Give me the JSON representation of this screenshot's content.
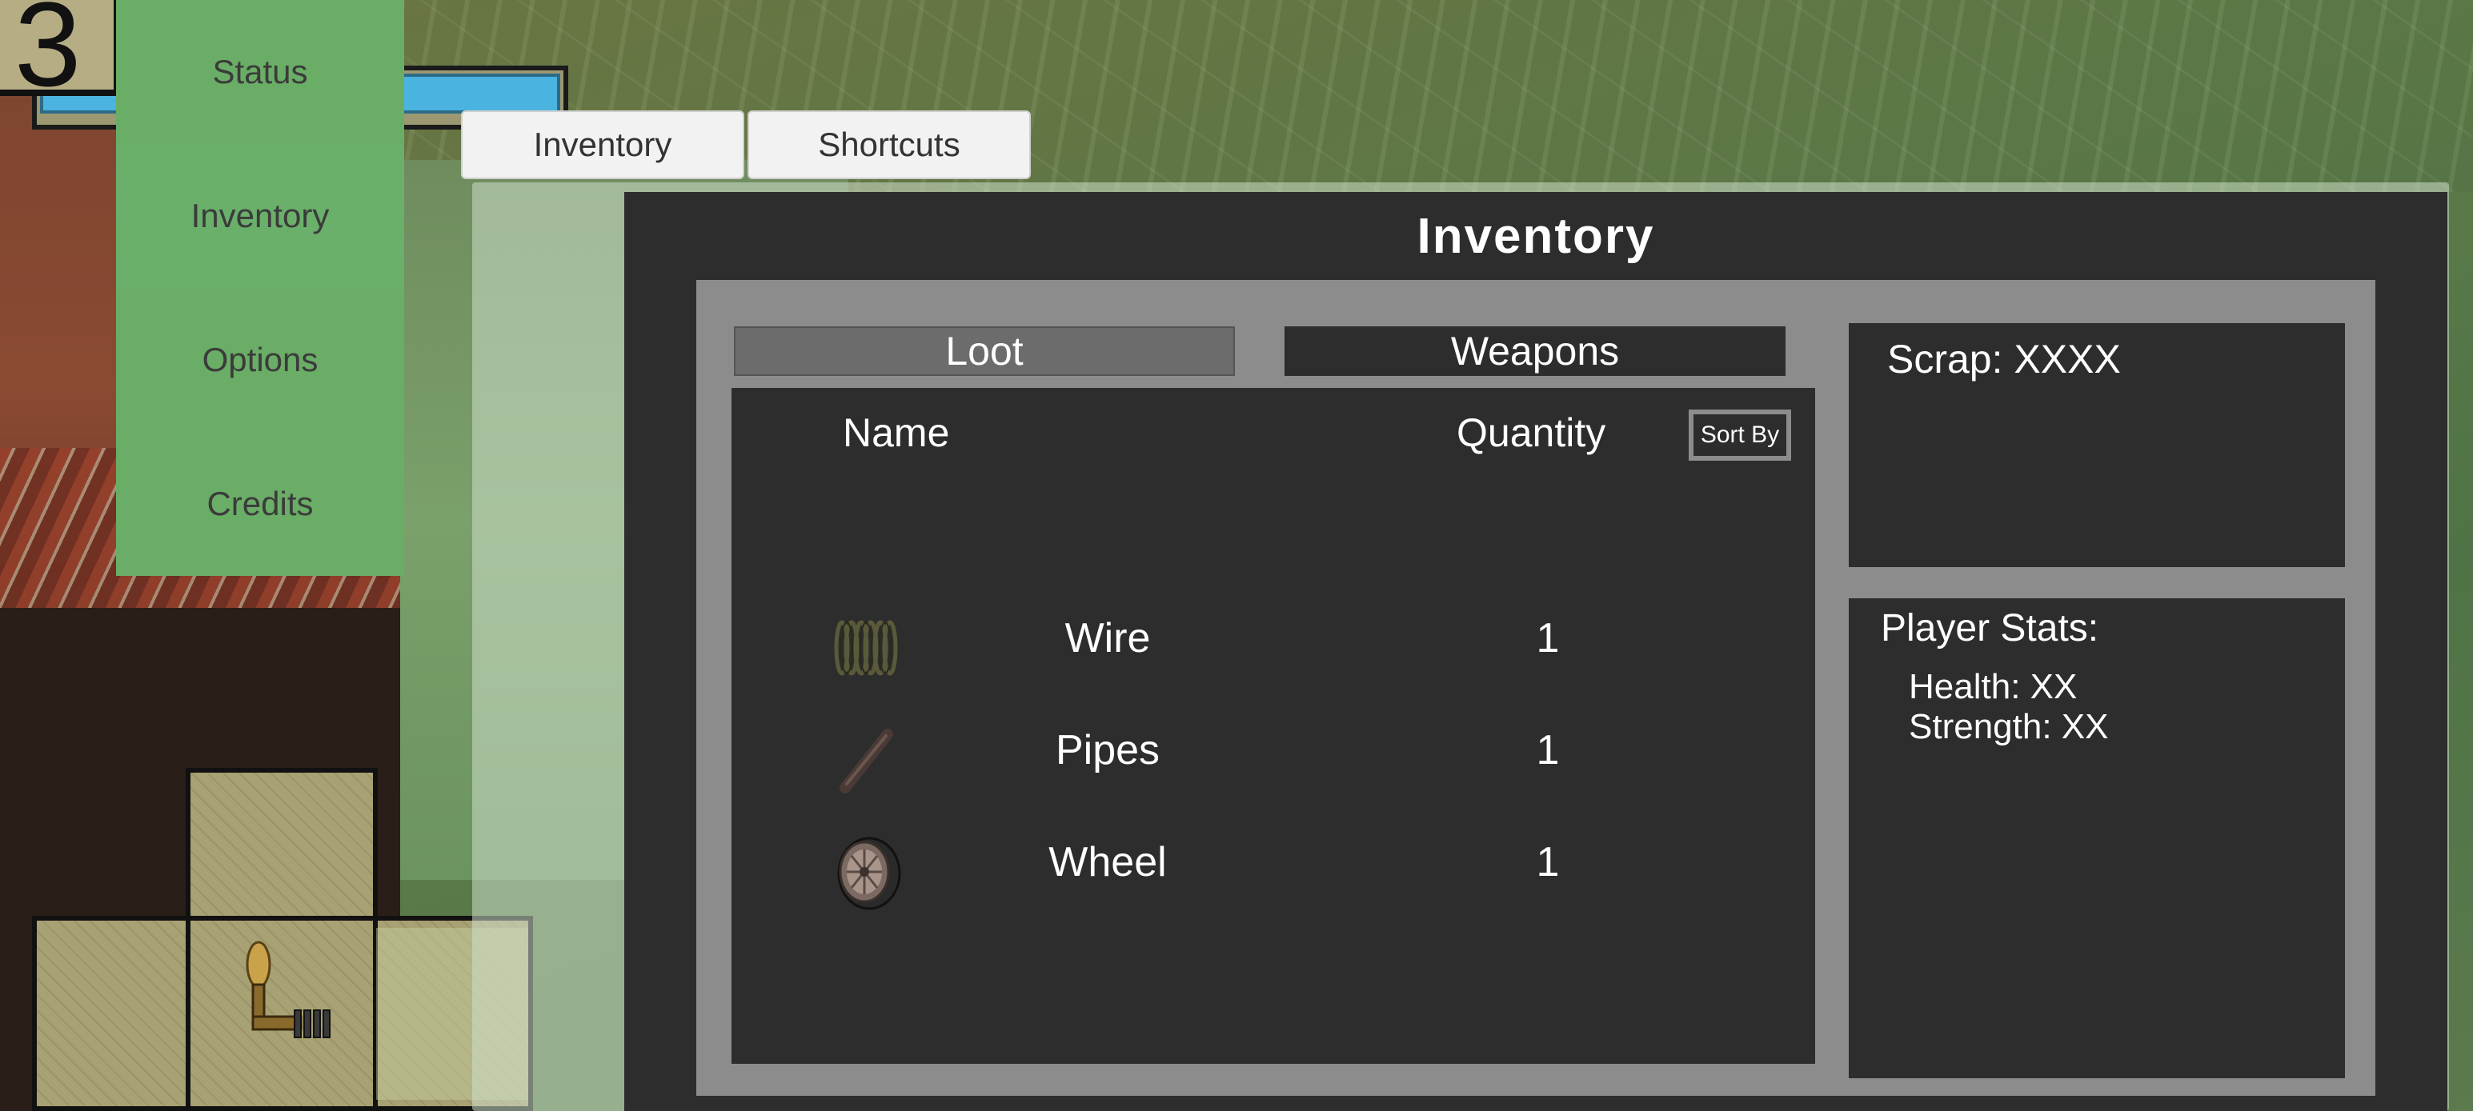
{
  "hud": {
    "level": "3"
  },
  "side_menu": {
    "items": [
      {
        "label": "Status"
      },
      {
        "label": "Inventory"
      },
      {
        "label": "Options"
      },
      {
        "label": "Credits"
      }
    ]
  },
  "top_tabs": [
    {
      "label": "Inventory"
    },
    {
      "label": "Shortcuts"
    }
  ],
  "inventory": {
    "title": "Inventory",
    "categories": [
      {
        "label": "Loot",
        "selected": true
      },
      {
        "label": "Weapons",
        "selected": false
      }
    ],
    "columns": {
      "name": "Name",
      "quantity": "Quantity"
    },
    "sort_label": "Sort By",
    "items": [
      {
        "name": "Wire",
        "quantity": "1",
        "icon": "wire-coil-icon"
      },
      {
        "name": "Pipes",
        "quantity": "1",
        "icon": "pipe-icon"
      },
      {
        "name": "Wheel",
        "quantity": "1",
        "icon": "wheel-icon"
      }
    ]
  },
  "scrap": {
    "text": "Scrap: XXXX"
  },
  "player_stats": {
    "title": "Player Stats:",
    "health": "Health: XX",
    "strength": "Strength: XX"
  },
  "colors": {
    "menu_green": "#6aad66",
    "panel_dark": "#2d2d2d",
    "panel_frame": "#8c8c8c",
    "xp_bar": "#4ab3e0"
  }
}
